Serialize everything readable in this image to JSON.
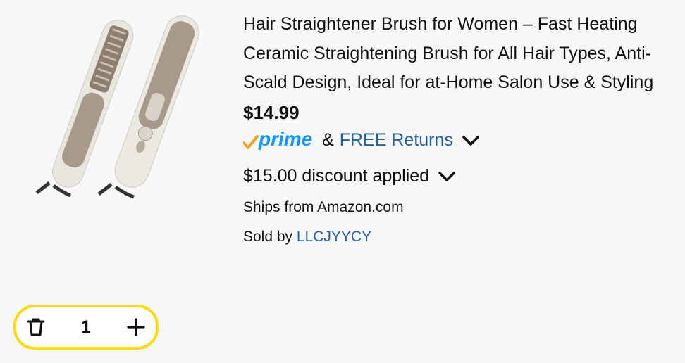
{
  "product": {
    "title": "Hair Straightener Brush for Women – Fast Heating Ceramic Straightening Brush for All Hair Types, Anti-Scald Design, Ideal for at-Home Salon Use & Styling",
    "price": "$14.99",
    "prime_label": "prime",
    "ampersand": "&",
    "free_returns": "FREE Returns",
    "discount": "$15.00 discount applied",
    "ships_from": "Ships from Amazon.com",
    "sold_by_prefix": "Sold by",
    "seller": "LLCJYYCY"
  },
  "cart": {
    "quantity": "1"
  },
  "icons": {
    "prime_check": "prime-check-icon",
    "chevron": "chevron-down-icon",
    "delete": "trash-icon",
    "add": "plus-icon"
  },
  "colors": {
    "link": "#2162a1",
    "prime_blue": "#1399ff",
    "prime_orange": "#f7a21b",
    "stepper_border": "#ffd814"
  }
}
